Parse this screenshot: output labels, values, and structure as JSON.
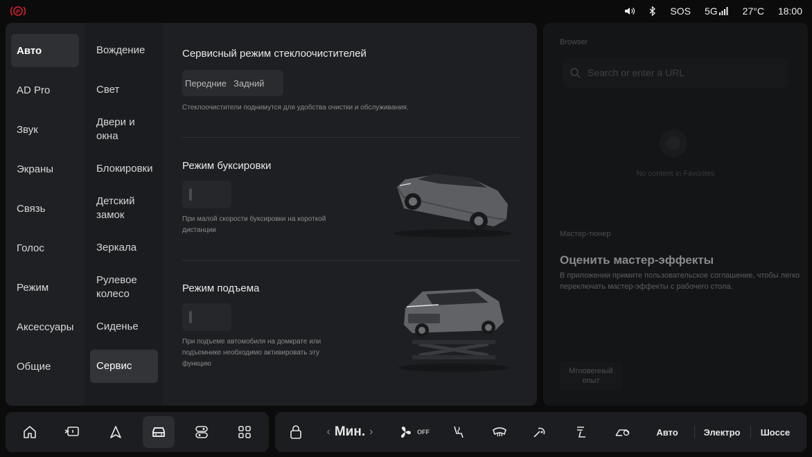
{
  "status": {
    "sos": "SOS",
    "network": "5G",
    "temperature": "27°C",
    "time": "18:00",
    "icons": [
      "parking-brake-icon",
      "volume-icon",
      "bluetooth-icon",
      "signal-icon"
    ]
  },
  "nav1": {
    "items": [
      "Авто",
      "AD Pro",
      "Звук",
      "Экраны",
      "Связь",
      "Голос",
      "Режим",
      "Аксессуары",
      "Общие"
    ],
    "active": "Авто"
  },
  "nav2": {
    "items": [
      "Вождение",
      "Свет",
      "Двери и окна",
      "Блокировки",
      "Детский замок",
      "Зеркала",
      "Рулевое колесо",
      "Сиденье",
      "Сервис"
    ],
    "active": "Сервис"
  },
  "service": {
    "wiper_title": "Сервисный режим стеклоочистителей",
    "wiper_front": "Передние",
    "wiper_rear": "Задний",
    "wiper_desc": "Стеклоочистители поднимутся для удобства очистки и обслуживания.",
    "tow_title": "Режим буксировки",
    "tow_desc": "При малой скорости буксировки на короткой дистанции",
    "tow_enabled": false,
    "lift_title": "Режим подъема",
    "lift_desc": "При подъеме автомобиля на домкрате или подъемнике необходимо активировать эту функцию",
    "lift_enabled": false
  },
  "browser": {
    "label": "Browser",
    "search_placeholder": "Search or enter a URL",
    "empty": "No content in Favorites"
  },
  "master": {
    "label": "Мастер-тюнер",
    "title": "Оценить мастер-эффекты",
    "text": "В приложении примите пользовательское соглашение, чтобы легко переключать мастер-эффекты с рабочего стола.",
    "instant": "Мгновенный опыт"
  },
  "dock": {
    "apps": [
      "home-icon",
      "rear-seat-icon",
      "navigation-icon",
      "car-icon",
      "toggle-icon",
      "apps-grid-icon"
    ],
    "active_app": "car-icon"
  },
  "climate": {
    "fan_level": "Мин.",
    "fan_off": "OFF",
    "modes": [
      "Авто",
      "Электро",
      "Шоссе"
    ]
  },
  "colors": {
    "accent_red": "#d8242c",
    "panel": "#1c1d20",
    "background": "#0b0b0c"
  }
}
